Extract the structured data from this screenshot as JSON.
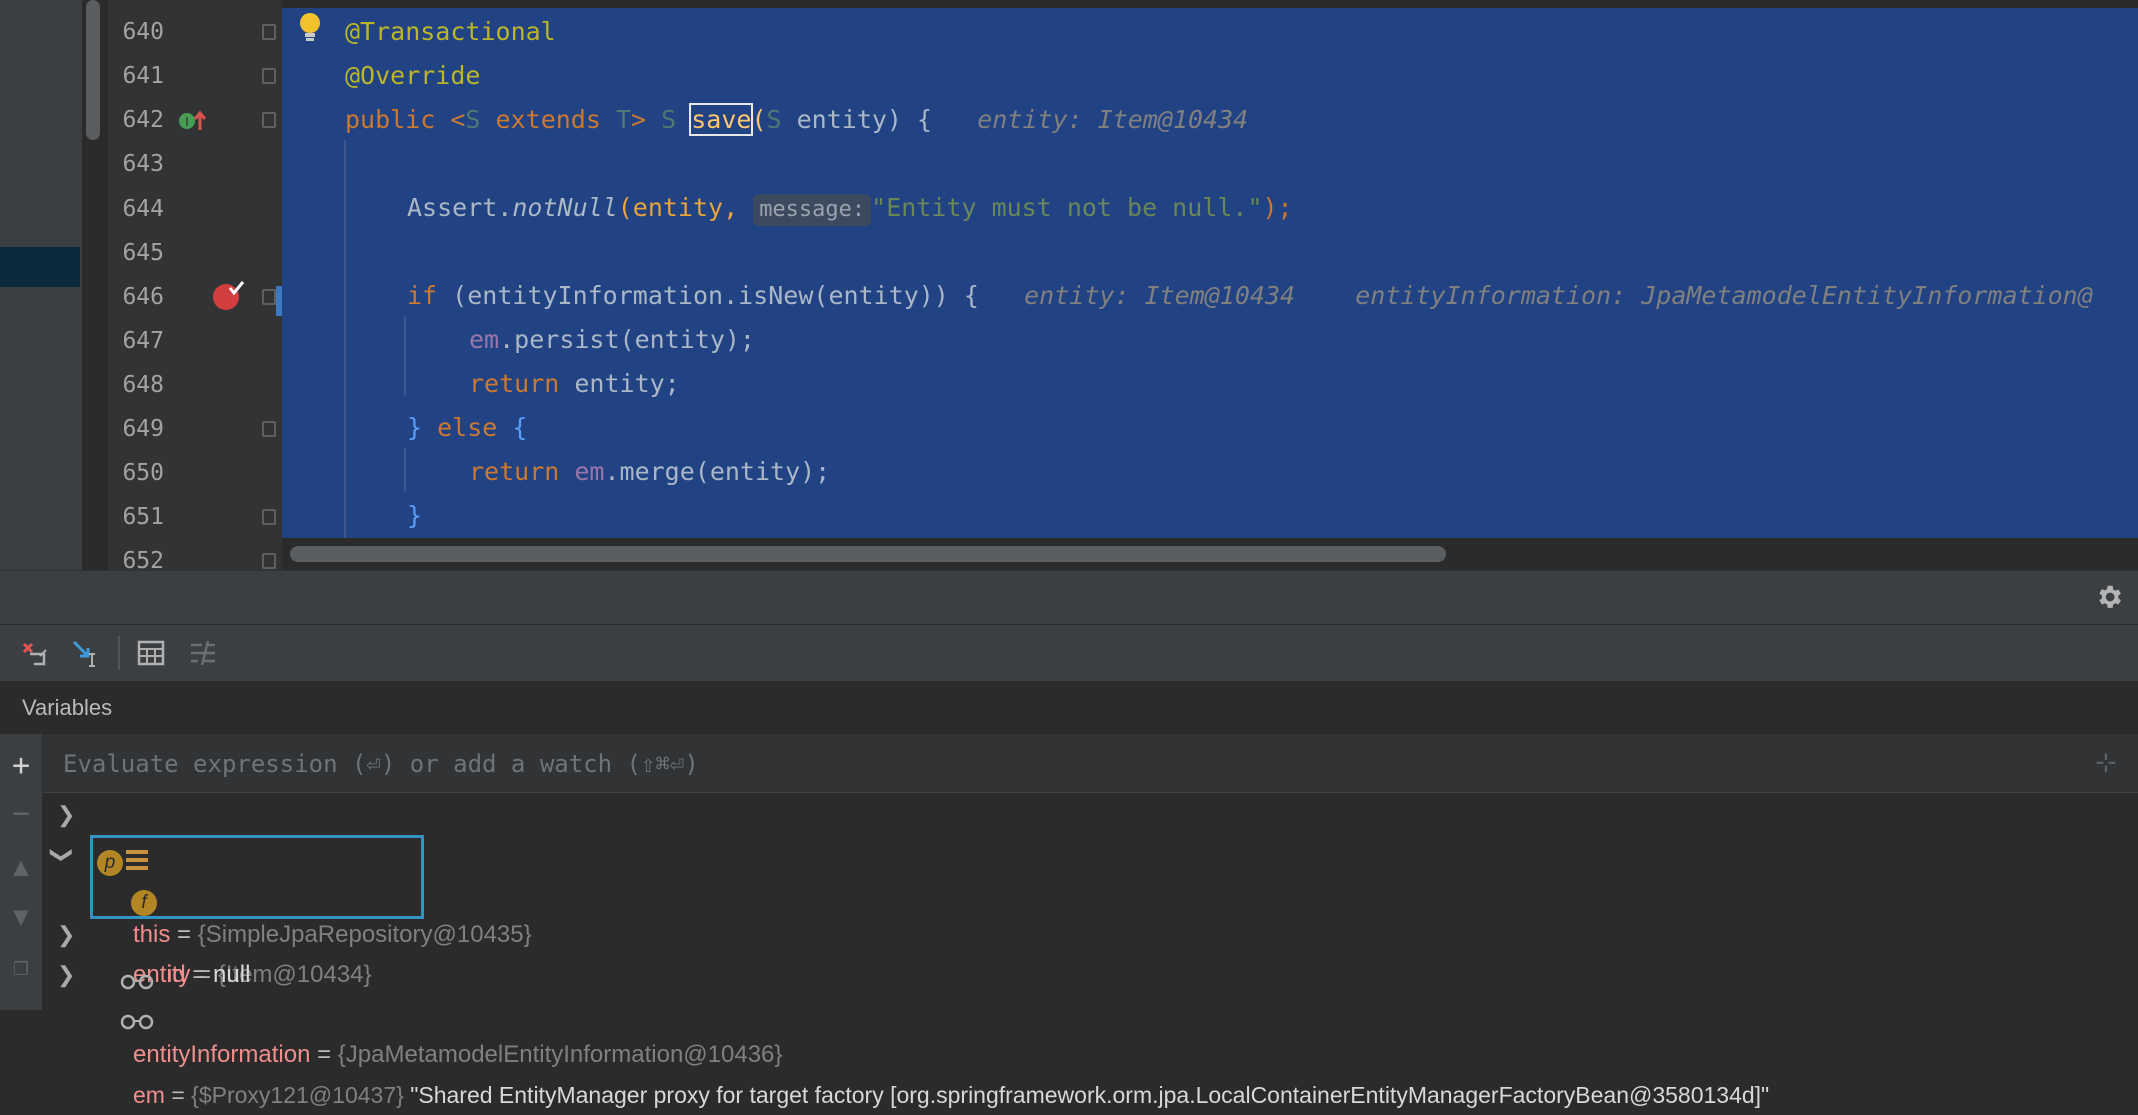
{
  "editor": {
    "line_numbers": [
      "640",
      "641",
      "642",
      "643",
      "644",
      "645",
      "646",
      "647",
      "648",
      "649",
      "650",
      "651",
      "652"
    ],
    "lines": {
      "l640": "@Transactional",
      "l641": "@Override",
      "l642_public": "public",
      "l642_lt": " <",
      "l642_S": "S",
      "l642_extends": " extends",
      "l642_T": " T",
      "l642_gt": "> ",
      "l642_S2": "S ",
      "l642_save": "save",
      "l642_open": "(",
      "l642_S3": "S",
      "l642_param": " entity) {",
      "l642_hint": "   entity: Item@10434",
      "l644_assert": "Assert.",
      "l644_notnull": "notNull",
      "l644_args": "(entity, ",
      "l644_hint": "message:",
      "l644_str": "\"Entity must not be null.\"",
      "l644_end": ");",
      "l646_if": "if",
      "l646_cond": " (entityInformation.isNew(entity)) {",
      "l646_hint1": "   entity: Item@10434",
      "l646_hint2": "    entityInformation: JpaMetamodelEntityInformation@",
      "l647_em": "em",
      "l647_rest": ".persist(entity);",
      "l648_return": "return",
      "l648_rest": " entity;",
      "l649_close": "} ",
      "l649_else": "else",
      "l649_brace": " {",
      "l650_return": "return",
      "l650_em": " em",
      "l650_rest": ".merge(entity);",
      "l651": "}"
    }
  },
  "debugger": {
    "panel_title": "Variables",
    "watch_placeholder": "Evaluate expression (⏎) or add a watch (⇧⌘⏎)",
    "variables": [
      {
        "name": "this",
        "eq": " = ",
        "value": "{SimpleJpaRepository@10435}",
        "icon": "field-list-icon"
      },
      {
        "name": "entity",
        "eq": " = ",
        "value": "{Item@10434}",
        "icon": "parameter-icon",
        "badge": "p"
      },
      {
        "name": "id",
        "eq": " = ",
        "value": "null",
        "icon": "field-icon",
        "badge": "f"
      },
      {
        "name": "entityInformation",
        "eq": " = ",
        "value": "{JpaMetamodelEntityInformation@10436}",
        "icon": "watch-glasses-icon"
      },
      {
        "name": "em",
        "eq": " = ",
        "value": "{$Proxy121@10437}",
        "extra": " \"Shared EntityManager proxy for target factory [org.springframework.orm.jpa.LocalContainerEntityManagerFactoryBean@3580134d]\"",
        "icon": "watch-glasses-icon"
      }
    ]
  },
  "colors": {
    "selection": "#214283",
    "keyword": "#cc7832",
    "annotation": "#bbb529",
    "string": "#6a8759",
    "highlight_box": "#3592c4",
    "var_name": "#f08d8d"
  }
}
